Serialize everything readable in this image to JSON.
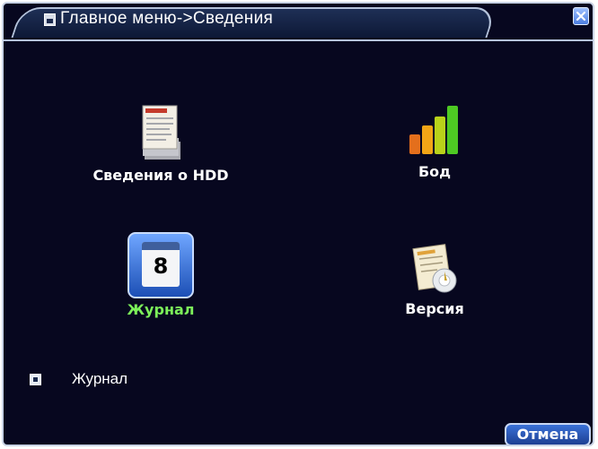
{
  "window": {
    "title": "Главное меню->Сведения",
    "colors": {
      "background": "#07071f",
      "border": "#c9d3e4",
      "active_label": "#7cf05a"
    }
  },
  "menu": {
    "items": [
      {
        "label": "Сведения о HDD",
        "icon": "hdd-info-document-icon"
      },
      {
        "label": "Бод",
        "icon": "bar-chart-icon"
      },
      {
        "label": "Журнал",
        "icon": "calendar-icon",
        "selected": true
      },
      {
        "label": "Версия",
        "icon": "version-document-icon"
      }
    ]
  },
  "icon_text": {
    "calendar_day": "8"
  },
  "status": {
    "text": "Журнал",
    "icon": "status-square-icon"
  },
  "buttons": {
    "cancel_label": "Отмена",
    "close_icon": "close-icon"
  }
}
